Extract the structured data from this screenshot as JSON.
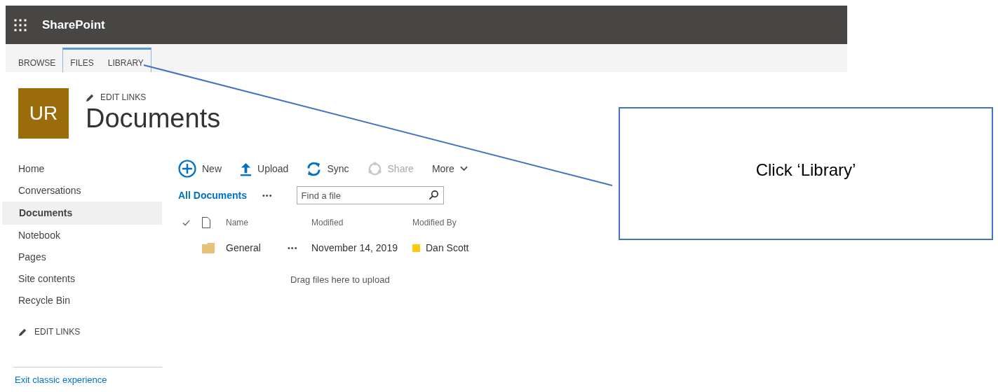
{
  "suite_bar": {
    "title": "SharePoint"
  },
  "ribbon_tabs": [
    {
      "label": "BROWSE",
      "grouped": false
    },
    {
      "label": "FILES",
      "grouped": true
    },
    {
      "label": "LIBRARY",
      "grouped": true
    }
  ],
  "site": {
    "logo": "UR",
    "edit_links": "EDIT LINKS",
    "title": "Documents"
  },
  "nav": {
    "items": [
      {
        "label": "Home",
        "selected": false
      },
      {
        "label": "Conversations",
        "selected": false
      },
      {
        "label": "Documents",
        "selected": true
      },
      {
        "label": "Notebook",
        "selected": false
      },
      {
        "label": "Pages",
        "selected": false
      },
      {
        "label": "Site contents",
        "selected": false
      },
      {
        "label": "Recycle Bin",
        "selected": false
      }
    ],
    "edit_links": "EDIT LINKS",
    "exit_link": "Exit classic experience"
  },
  "commands": [
    {
      "kind": "new",
      "label": "New",
      "disabled": false
    },
    {
      "kind": "upload",
      "label": "Upload",
      "disabled": false
    },
    {
      "kind": "sync",
      "label": "Sync",
      "disabled": false
    },
    {
      "kind": "share",
      "label": "Share",
      "disabled": true
    },
    {
      "kind": "more",
      "label": "More",
      "disabled": false
    }
  ],
  "view": {
    "label": "All Documents",
    "ellipsis": "•••",
    "search_placeholder": "Find a file"
  },
  "table": {
    "columns": [
      "Name",
      "Modified",
      "Modified By"
    ],
    "rows": [
      {
        "name": "General",
        "menu": "•••",
        "modified": "November 14, 2019",
        "modified_by": "Dan Scott",
        "color": "#ffc90e"
      }
    ],
    "empty_hint": "Drag files here to upload"
  },
  "callout": {
    "text": "Click ‘Library’"
  }
}
